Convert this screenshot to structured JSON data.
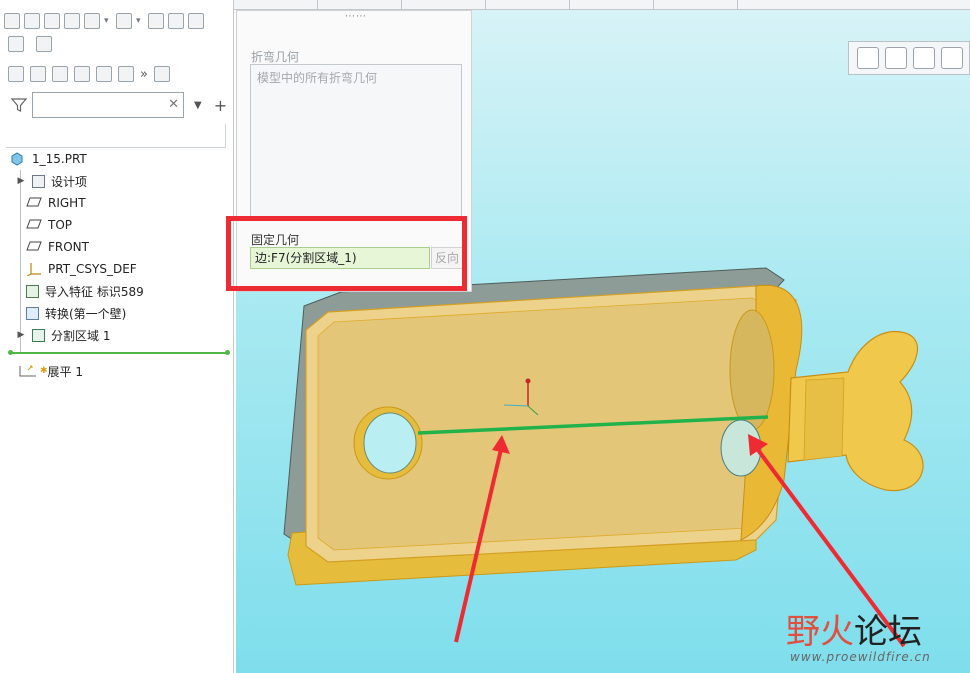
{
  "tree": {
    "root": "1_15.PRT",
    "items": [
      {
        "label": "设计项",
        "expand": true
      },
      {
        "label": "RIGHT"
      },
      {
        "label": "TOP"
      },
      {
        "label": "FRONT"
      },
      {
        "label": "PRT_CSYS_DEF"
      },
      {
        "label": "导入特征 标识589"
      },
      {
        "label": "转换(第一个壁)"
      },
      {
        "label": "分割区域 1",
        "expand": true
      }
    ],
    "after_insert": "展平 1"
  },
  "panel": {
    "handle": "⋯⋯",
    "bend_label": "折弯几何",
    "bend_placeholder": "模型中的所有折弯几何",
    "fixed_label": "固定几何",
    "fixed_value": "边:F7(分割区域_1)",
    "flip_label": "反向"
  },
  "toolbar": {
    "more": "»",
    "add": "+"
  },
  "watermark": {
    "brand_red": "野火",
    "brand_black": "论坛",
    "url": "www.proewildfire.cn"
  },
  "colors": {
    "highlight_box": "#ee2b32",
    "selected_edge": "#22b24c",
    "part_fill": "#e8c24a",
    "viewport_bg": "#9fe5ef"
  }
}
